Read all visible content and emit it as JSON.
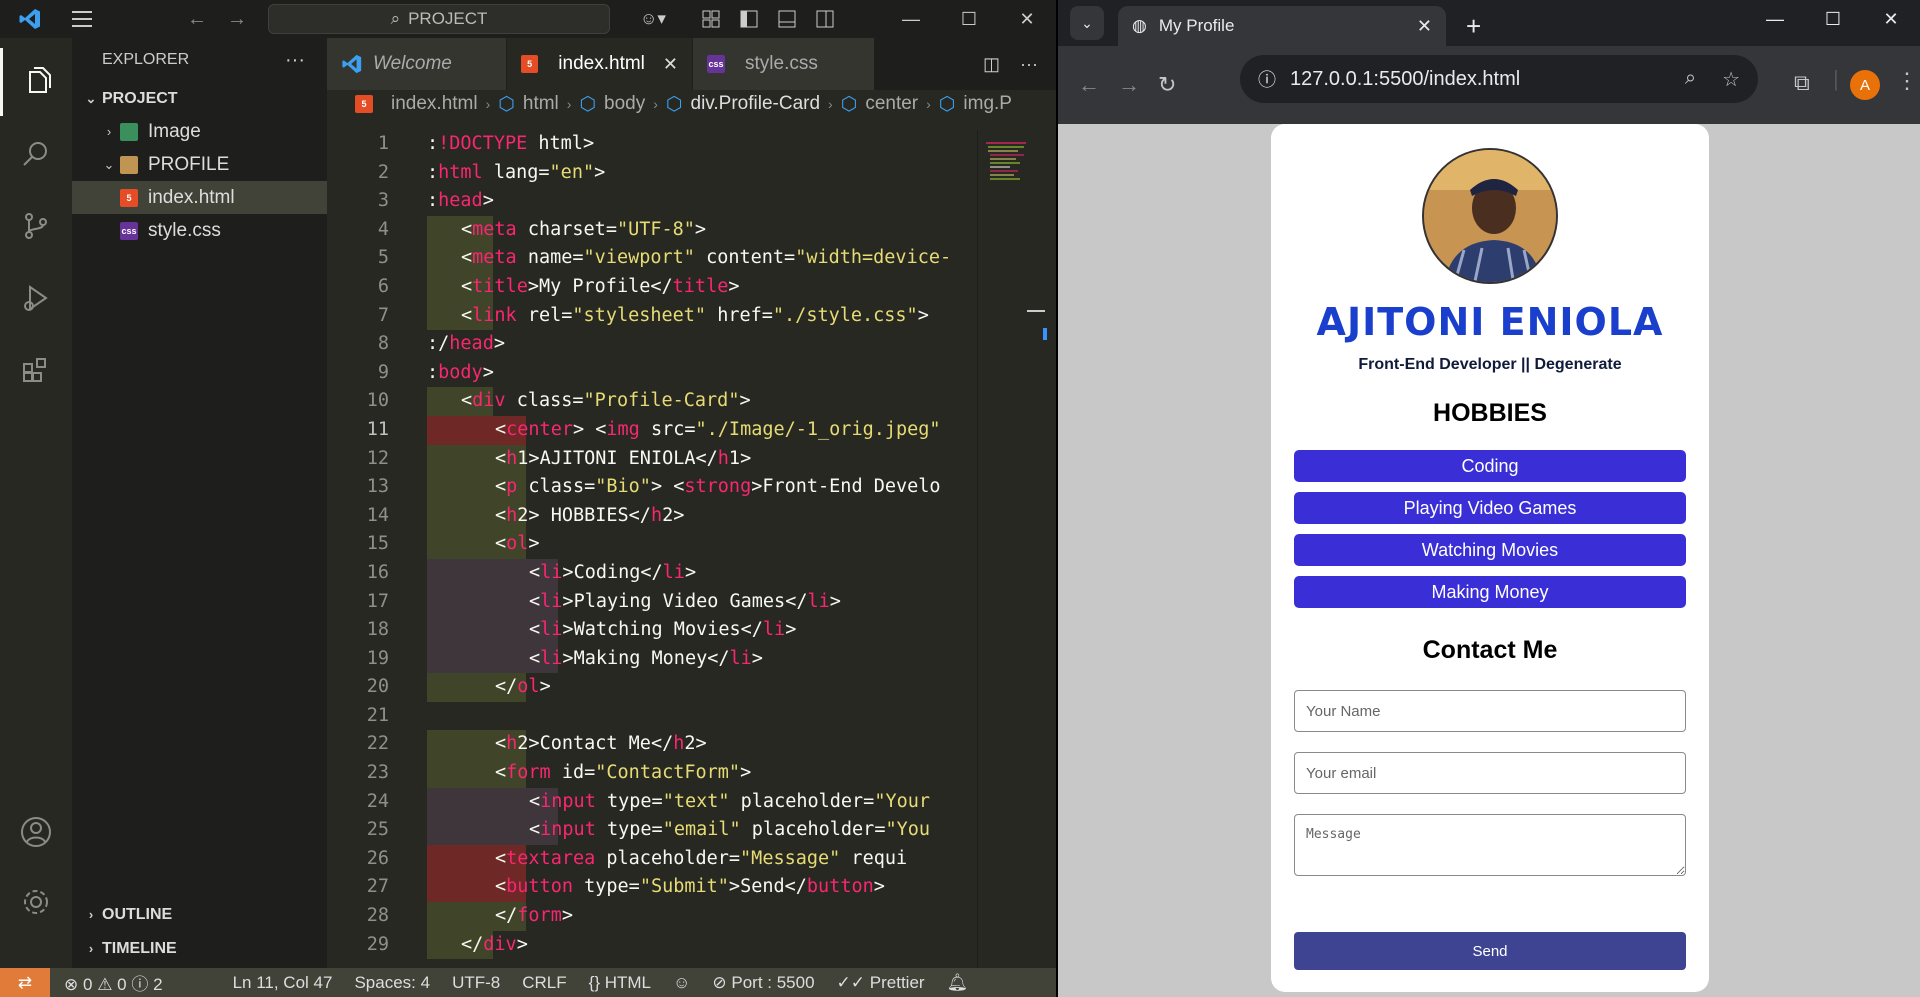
{
  "vscode": {
    "titlebar": {
      "search": "PROJECT"
    },
    "explorer": {
      "title": "EXPLORER",
      "section": "PROJECT",
      "items": [
        {
          "label": "Image",
          "type": "folder"
        },
        {
          "label": "PROFILE",
          "type": "folder"
        },
        {
          "label": "index.html",
          "type": "html"
        },
        {
          "label": "style.css",
          "type": "css"
        }
      ],
      "outline": "OUTLINE",
      "timeline": "TIMELINE"
    },
    "tabs": [
      {
        "label": "Welcome"
      },
      {
        "label": "index.html"
      },
      {
        "label": "style.css"
      }
    ],
    "breadcrumb": [
      "index.html",
      "html",
      "body",
      "div.Profile-Card",
      "center",
      "img.P"
    ],
    "code_lines": [
      ":!DOCTYPE html>",
      ":html lang=\"en\">",
      ":head>",
      "<meta charset=\"UTF-8\">",
      "<meta name=\"viewport\" content=\"width=device-",
      "<title>My Profile</title>",
      "<link rel=\"stylesheet\" href=\"./style.css\">",
      ":/head>",
      ":body>",
      "<div class=\"Profile-Card\">",
      "<center> <img src=\"./Image/-1_orig.jpeg\"",
      "<h1>AJITONI ENIOLA</h1>",
      "<p class=\"Bio\"> <strong>Front-End Develo",
      "<h2> HOBBIES</h2>",
      "<ol>",
      "<li>Coding</li>",
      "<li>Playing Video Games</li>",
      "<li>Watching Movies</li>",
      "<li>Making Money</li>",
      "</ol>",
      "",
      "<h2>Contact Me</h2>",
      "<form id=\"ContactForm\">",
      "<input type=\"text\" placeholder=\"Your",
      "<input type=\"email\" placeholder=\"You",
      "<textarea placeholder=\"Message\" requi",
      "<button type=\"Submit\">Send</button>",
      "</form>",
      "</div>"
    ],
    "status": {
      "errors": "0",
      "warnings": "0",
      "info": "2",
      "position": "Ln 11, Col 47",
      "spaces": "Spaces: 4",
      "encoding": "UTF-8",
      "eol": "CRLF",
      "language": "HTML",
      "port": "Port : 5500",
      "prettier": "Prettier"
    }
  },
  "browser": {
    "tab_title": "My Profile",
    "url": "127.0.0.1:5500/index.html",
    "profile_initial": "A",
    "page": {
      "name": "AJITONI ENIOLA",
      "bio": "Front-End Developer || Degenerate",
      "hobbies_title": "HOBBIES",
      "hobbies": [
        "Coding",
        "Playing Video Games",
        "Watching Movies",
        "Making Money"
      ],
      "contact_title": "Contact Me",
      "name_placeholder": "Your Name",
      "email_placeholder": "Your email",
      "message_placeholder": "Message",
      "send_label": "Send"
    }
  },
  "colors": {
    "name_blue": "#1a3fcc",
    "hobby_bg": "#3a2fd6",
    "send_bg": "#3e4492",
    "monokai_bg": "#272822"
  }
}
